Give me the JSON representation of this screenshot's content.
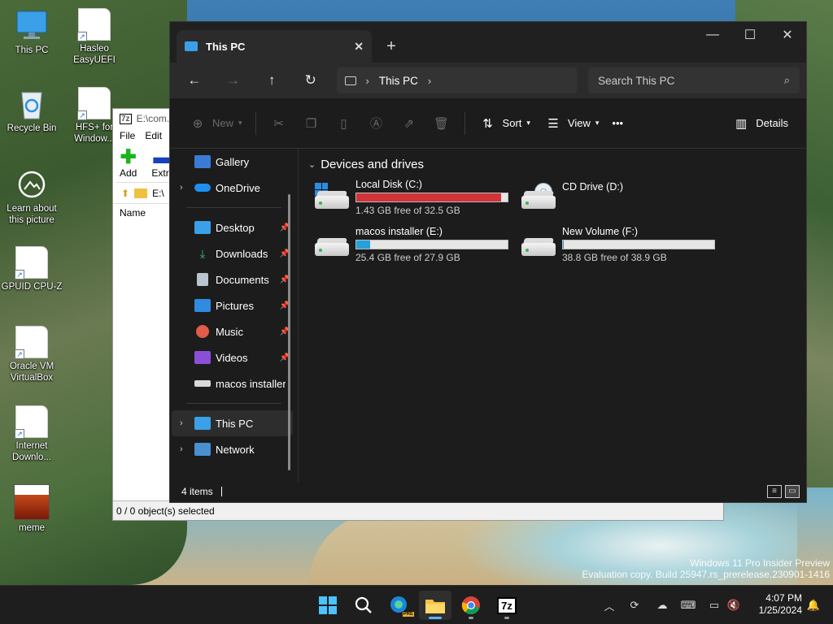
{
  "desktop": {
    "icons": [
      {
        "label": "This PC"
      },
      {
        "label": "Hasleo EasyUEFI"
      },
      {
        "label": "Recycle Bin"
      },
      {
        "label": "HFS+ for Window..."
      },
      {
        "label": "Learn about this picture"
      },
      {
        "label": "GPUID CPU-Z"
      },
      {
        "label": "Oracle VM VirtualBox"
      },
      {
        "label": "Internet Downlo..."
      },
      {
        "label": "meme"
      }
    ],
    "watermark": {
      "line1": "Windows 11 Pro Insider Preview",
      "line2": "Evaluation copy. Build 25947.rs_prerelease.230901-1416"
    }
  },
  "zip_window": {
    "title": "E:\\com...",
    "menu": [
      "File",
      "Edit"
    ],
    "toolbar": {
      "add": "Add",
      "extract": "Extra"
    },
    "address": "E:\\",
    "column_name": "Name",
    "status": "0 / 0 object(s) selected"
  },
  "explorer": {
    "tab_title": "This PC",
    "new_tab_symbol": "+",
    "address": {
      "location": "This PC"
    },
    "search": {
      "placeholder": "Search This PC"
    },
    "commands": {
      "new": "New",
      "sort": "Sort",
      "view": "View",
      "more": "•••",
      "details": "Details"
    },
    "nav": {
      "gallery": "Gallery",
      "onedrive": "OneDrive",
      "desktop": "Desktop",
      "downloads": "Downloads",
      "documents": "Documents",
      "pictures": "Pictures",
      "music": "Music",
      "videos": "Videos",
      "macos": "macos installer (",
      "thispc": "This PC",
      "network": "Network"
    },
    "group_header": "Devices and drives",
    "drives": [
      {
        "name": "Local Disk (C:)",
        "free": "1.43 GB free of 32.5 GB",
        "used_fraction": 0.956,
        "bar_color": "#d13438"
      },
      {
        "name": "CD Drive (D:)",
        "free": "",
        "used_fraction": null,
        "bar_color": ""
      },
      {
        "name": "macos installer (E:)",
        "free": "25.4 GB free of 27.9 GB",
        "used_fraction": 0.09,
        "bar_color": "#26a0da"
      },
      {
        "name": "New Volume (F:)",
        "free": "38.8 GB free of 38.9 GB",
        "used_fraction": 0.003,
        "bar_color": "#26a0da"
      }
    ],
    "status": {
      "items": "4 items"
    }
  },
  "taskbar": {
    "clock": {
      "time": "4:07 PM",
      "date": "1/25/2024"
    },
    "apps": [
      "start-icon",
      "search-icon",
      "edge-pre-icon",
      "file-explorer-icon",
      "chrome-icon",
      "7zip-icon"
    ],
    "zip_label": "7z",
    "edge_badge": "PRE"
  }
}
